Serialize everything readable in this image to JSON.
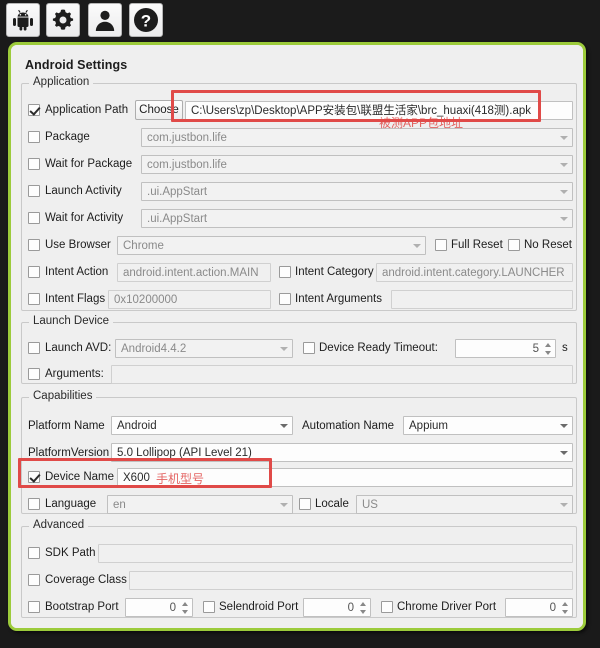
{
  "window": {
    "title": "Android Settings",
    "accent_green": "#9ccb3b",
    "annotation_red": "#e04a48"
  },
  "toolbar": {
    "buttons": [
      {
        "name": "android-icon",
        "tooltip": "Android"
      },
      {
        "name": "gear-icon",
        "tooltip": "Settings"
      },
      {
        "name": "user-icon",
        "tooltip": "User"
      },
      {
        "name": "help-icon",
        "tooltip": "Help"
      }
    ]
  },
  "application": {
    "legend": "Application",
    "application_path": {
      "label": "Application Path",
      "checked": true,
      "choose_label": "Choose",
      "value": "C:\\Users\\zp\\Desktop\\APP安装包\\联盟生活家\\brc_huaxi(418测).apk"
    },
    "package": {
      "label": "Package",
      "checked": false,
      "value": "com.justbon.life"
    },
    "wait_for_package": {
      "label": "Wait for Package",
      "checked": false,
      "value": "com.justbon.life"
    },
    "launch_activity": {
      "label": "Launch Activity",
      "checked": false,
      "value": ".ui.AppStart"
    },
    "wait_for_activity": {
      "label": "Wait for Activity",
      "checked": false,
      "value": ".ui.AppStart"
    },
    "use_browser": {
      "label": "Use Browser",
      "checked": false,
      "value": "Chrome"
    },
    "full_reset": {
      "label": "Full Reset",
      "checked": false
    },
    "no_reset": {
      "label": "No Reset",
      "checked": false
    },
    "intent_action": {
      "label": "Intent Action",
      "checked": false,
      "value": "android.intent.action.MAIN"
    },
    "intent_category": {
      "label": "Intent Category",
      "checked": false,
      "value": "android.intent.category.LAUNCHER"
    },
    "intent_flags": {
      "label": "Intent Flags",
      "checked": false,
      "value": "0x10200000"
    },
    "intent_arguments": {
      "label": "Intent Arguments",
      "checked": false,
      "value": ""
    }
  },
  "launch_device": {
    "legend": "Launch Device",
    "launch_avd": {
      "label": "Launch AVD:",
      "checked": false,
      "value": "Android4.4.2"
    },
    "device_ready_timeout": {
      "label": "Device Ready Timeout:",
      "checked": false,
      "value": "5",
      "unit": "s"
    },
    "arguments": {
      "label": "Arguments:",
      "checked": false,
      "value": ""
    }
  },
  "capabilities": {
    "legend": "Capabilities",
    "platform_name": {
      "label": "Platform Name",
      "value": "Android"
    },
    "automation_name": {
      "label": "Automation Name",
      "value": "Appium"
    },
    "platform_version": {
      "label": "PlatformVersion",
      "value": "5.0 Lollipop (API Level 21)"
    },
    "device_name": {
      "label": "Device Name",
      "checked": true,
      "value": "X600"
    },
    "language": {
      "label": "Language",
      "checked": false,
      "value": "en"
    },
    "locale": {
      "label": "Locale",
      "checked": false,
      "value": "US"
    }
  },
  "advanced": {
    "legend": "Advanced",
    "sdk_path": {
      "label": "SDK Path",
      "checked": false,
      "value": ""
    },
    "coverage_class": {
      "label": "Coverage Class",
      "checked": false,
      "value": ""
    },
    "bootstrap_port": {
      "label": "Bootstrap Port",
      "checked": false,
      "value": "0"
    },
    "selendroid_port": {
      "label": "Selendroid Port",
      "checked": false,
      "value": "0"
    },
    "chrome_driver_port": {
      "label": "Chrome Driver Port",
      "checked": false,
      "value": "0"
    }
  },
  "annotations": {
    "app_path_note": "被测APP包地址",
    "device_name_note": "手机型号"
  }
}
